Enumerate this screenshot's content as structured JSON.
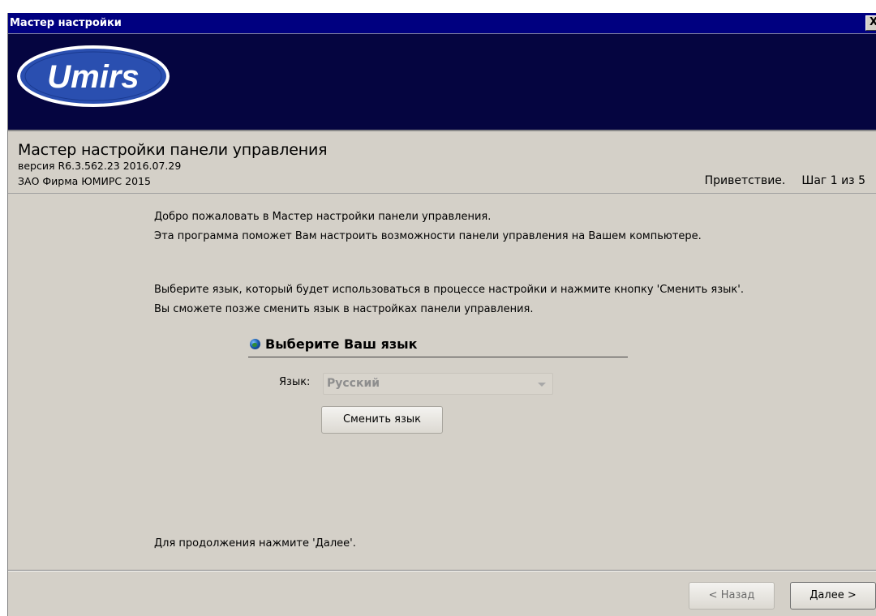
{
  "window": {
    "title": "Мастер настройки",
    "close_label": "X"
  },
  "banner": {
    "logo_text": "Umirs",
    "background_color": "#050540"
  },
  "header": {
    "title": "Мастер настройки панели управления",
    "version": "версия R6.3.562.23 2016.07.29",
    "company": "ЗАО Фирма ЮМИРС 2015",
    "step_name": "Приветствие.",
    "step_counter": "Шаг 1 из 5"
  },
  "main": {
    "welcome_line1": "Добро пожаловать в Мастер настройки панели управления.",
    "welcome_line2": "Эта программа поможет Вам настроить возможности панели управления на Вашем компьютере.",
    "choose_line1": "Выберите язык, который будет использоваться в процессе настройки и нажмите кнопку 'Сменить язык'.",
    "choose_line2": "Вы сможете позже сменить язык в настройках панели управления.",
    "section_title": "Выберите Ваш язык",
    "language_label": "Язык:",
    "language_value": "Русский",
    "change_language_button": "Сменить язык",
    "continue_hint": "Для продолжения нажмите 'Далее'."
  },
  "footer": {
    "back_button": "< Назад",
    "next_button": "Далее >"
  }
}
